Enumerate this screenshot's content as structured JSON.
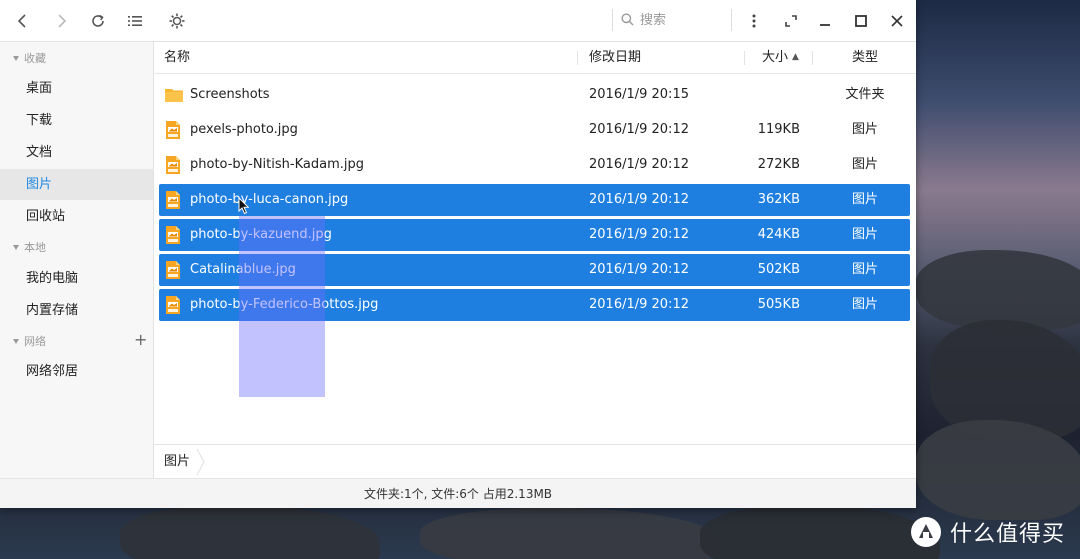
{
  "toolbar": {
    "search_placeholder": "搜索",
    "buttons": [
      "back-icon",
      "forward-icon",
      "refresh-icon",
      "list-view-icon",
      "settings-icon",
      "more-icon",
      "fullscreen-icon",
      "minimize-icon",
      "maximize-icon",
      "close-icon"
    ]
  },
  "sidebar": {
    "sections": [
      {
        "label": "收藏",
        "items": [
          "桌面",
          "下载",
          "文档",
          "图片",
          "回收站"
        ]
      },
      {
        "label": "本地",
        "items": [
          "我的电脑",
          "内置存储"
        ]
      },
      {
        "label": "网络",
        "items": [
          "网络邻居"
        ]
      }
    ],
    "active_item": "图片"
  },
  "columns": {
    "name": "名称",
    "date": "修改日期",
    "size": "大小",
    "size_sort": "▲",
    "type": "类型"
  },
  "files": [
    {
      "name": "Screenshots",
      "date": "2016/1/9 20:15",
      "size": "",
      "type": "文件夹",
      "icon": "folder-icon",
      "selected": false
    },
    {
      "name": "pexels-photo.jpg",
      "date": "2016/1/9 20:12",
      "size": "119KB",
      "type": "图片",
      "icon": "jpg-file-icon",
      "selected": false
    },
    {
      "name": "photo-by-Nitish-Kadam.jpg",
      "date": "2016/1/9 20:12",
      "size": "272KB",
      "type": "图片",
      "icon": "jpg-file-icon",
      "selected": false
    },
    {
      "name": "photo-by-luca-canon.jpg",
      "date": "2016/1/9 20:12",
      "size": "362KB",
      "type": "图片",
      "icon": "jpg-file-icon",
      "selected": true
    },
    {
      "name": "photo-by-kazuend.jpg",
      "date": "2016/1/9 20:12",
      "size": "424KB",
      "type": "图片",
      "icon": "jpg-file-icon",
      "selected": true
    },
    {
      "name": "Catalinablue.jpg",
      "date": "2016/1/9 20:12",
      "size": "502KB",
      "type": "图片",
      "icon": "jpg-file-icon",
      "selected": true
    },
    {
      "name": "photo-by-Federico-Bottos.jpg",
      "date": "2016/1/9 20:12",
      "size": "505KB",
      "type": "图片",
      "icon": "jpg-file-icon",
      "selected": true
    }
  ],
  "breadcrumb": {
    "current": "图片"
  },
  "status": {
    "text": "文件夹:1个, 文件:6个 占用2.13MB"
  },
  "watermark": {
    "text": "什么值得买"
  },
  "colors": {
    "selection": "#1e7fe0",
    "accent": "#1e88e5",
    "folder": "#f7b733"
  }
}
